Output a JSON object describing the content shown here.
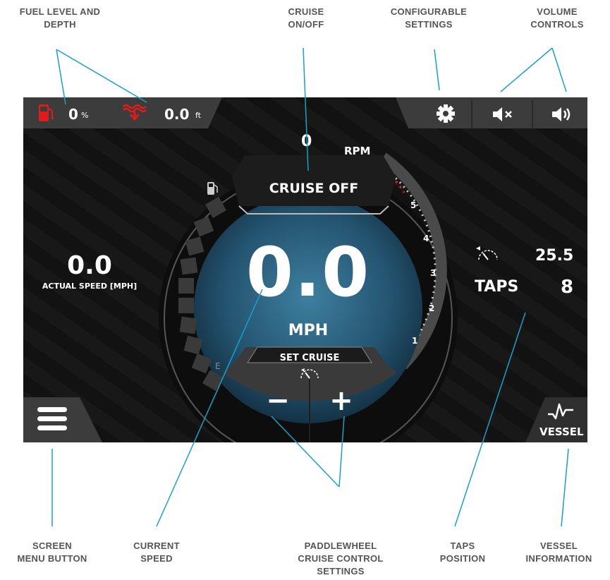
{
  "callouts": {
    "fuel_depth": [
      "FUEL LEVEL AND",
      "DEPTH"
    ],
    "cruise_toggle": [
      "CRUISE",
      "ON/OFF"
    ],
    "configurable": [
      "CONFIGURABLE",
      "SETTINGS"
    ],
    "volume": [
      "VOLUME",
      "CONTROLS"
    ],
    "screen_menu": [
      "SCREEN",
      "MENU BUTTON"
    ],
    "current_speed": [
      "CURRENT",
      "SPEED"
    ],
    "paddlewheel": [
      "PADDLEWHEEL",
      "CRUISE CONTROL",
      "SETTINGS"
    ],
    "taps_position": [
      "TAPS",
      "POSITION"
    ],
    "vessel_info": [
      "VESSEL",
      "INFORMATION"
    ]
  },
  "status_bar": {
    "fuel_value": "0",
    "fuel_unit": "%",
    "depth_value": "0.0",
    "depth_unit": "ft"
  },
  "gauge": {
    "rpm_value": "0",
    "rpm_label": "RPM",
    "cruise_button": "CRUISE OFF",
    "speed_value": "0.0",
    "speed_unit": "MPH",
    "set_cruise_label": "SET CRUISE",
    "minus_label": "−",
    "plus_label": "+",
    "fuel_empty_label": "E",
    "tach_ticks": [
      "1",
      "2",
      "3",
      "4",
      "5"
    ]
  },
  "left_panel": {
    "actual_speed_value": "0.0",
    "actual_speed_label": "ACTUAL SPEED [MPH]"
  },
  "right_panel": {
    "cruise_set_value": "25.5",
    "taps_label": "TAPS",
    "taps_value": "8"
  },
  "vessel_button_label": "VESSEL",
  "colors": {
    "accent_blue": "#1aa0c8",
    "fuel_red": "#e01b1b",
    "panel_dark": "#141414",
    "tab_gray": "#3a3a3a",
    "gauge_blue": "#2f6b88"
  },
  "icons": {
    "fuel": "fuel-pump-icon",
    "depth": "depth-wave-icon",
    "settings": "gear-icon",
    "mute": "mute-icon",
    "volume": "speaker-icon",
    "menu": "hamburger-menu-icon",
    "vessel": "pulse-icon",
    "cruise": "speedometer-icon"
  }
}
